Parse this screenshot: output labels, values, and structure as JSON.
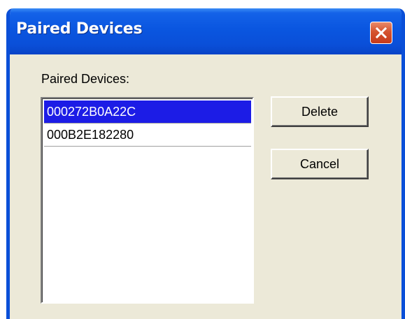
{
  "window": {
    "title": "Paired Devices"
  },
  "dialog": {
    "list_label": "Paired Devices:",
    "devices": [
      {
        "address": "000272B0A22C",
        "selected": true
      },
      {
        "address": "000B2E182280",
        "selected": false
      }
    ],
    "delete_label": "Delete",
    "cancel_label": "Cancel"
  },
  "colors": {
    "titlebar": "#0a4fd8",
    "selection": "#1c1ce6",
    "dialog_bg": "#ece9d8",
    "close_button": "#d5532f"
  },
  "icons": {
    "close": "close-icon"
  }
}
